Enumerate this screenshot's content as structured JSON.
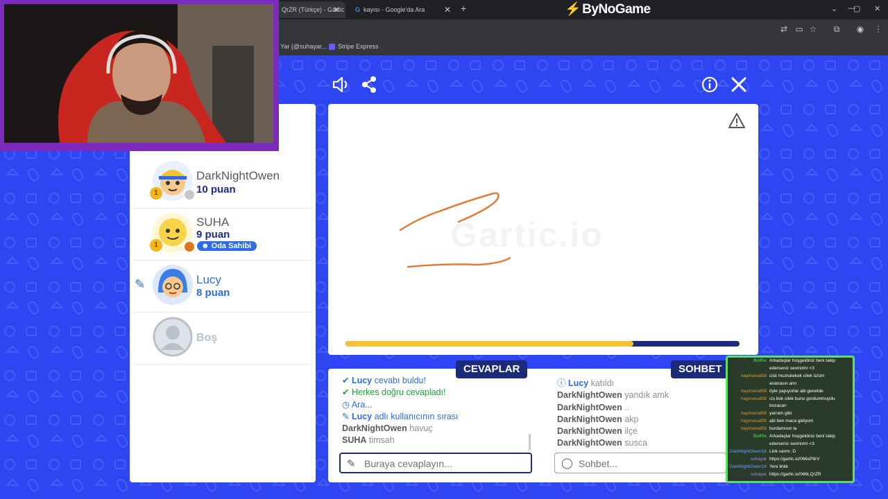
{
  "browser": {
    "tabs": [
      {
        "title": "QrZR (Türkçe) - Gartic",
        "active": true
      },
      {
        "title": "kayısı - Google'da Ara",
        "active": false
      }
    ],
    "brand": "ByNoGame",
    "bookmarks": [
      "Yar (@suhayar...",
      "Stripe Express"
    ]
  },
  "players": [
    {
      "name": "DarkNightOwen",
      "points": "10 puan",
      "rank": "1",
      "status_color": "#c8c8c8"
    },
    {
      "name": "SUHA",
      "points": "9 puan",
      "rank": "1",
      "badge": "Oda Sahibi",
      "status_color": "#e0761b"
    },
    {
      "name": "Lucy",
      "points": "8 puan",
      "drawing": true
    },
    {
      "name": "Boş"
    }
  ],
  "canvas": {
    "watermark": "Gartic.io",
    "progress": 0.73,
    "stroke_color": "#e07b39"
  },
  "answers": {
    "label": "CEVAPLAR",
    "messages": [
      {
        "user": "Lucy",
        "text": " cevabı buldu!",
        "kind": "system-blue"
      },
      {
        "user": "",
        "text": "Herkes doğru cevapladı!",
        "kind": "system-green"
      },
      {
        "user": "",
        "text": "Ara...",
        "kind": "system-blue"
      },
      {
        "user": "Lucy",
        "text": " adlı kullanıcının sırası",
        "kind": "system-blue"
      },
      {
        "user": "DarkNightOwen",
        "text": " havuç",
        "kind": "guess"
      },
      {
        "user": "SUHA",
        "text": " timsah",
        "kind": "guess"
      }
    ],
    "placeholder": "Buraya cevaplayın..."
  },
  "chat": {
    "label": "SOHBET",
    "messages": [
      {
        "user": "Lucy",
        "text": " katıldı",
        "kind": "system"
      },
      {
        "user": "DarkNightOwen",
        "text": " yandık amk"
      },
      {
        "user": "DarkNightOwen",
        "text": " .."
      },
      {
        "user": "DarkNightOwen",
        "text": " akp"
      },
      {
        "user": "DarkNightOwen",
        "text": " ilçe"
      },
      {
        "user": "DarkNightOwen",
        "text": " susca"
      }
    ],
    "placeholder": "Sohbet..."
  },
  "stream_chat": [
    {
      "user": "BotRix",
      "text": "Arkadaşlar hoşgeldiniz beni takip",
      "color": "#5ce06b"
    },
    {
      "user": "",
      "text": "ederseniz sevinirim <3",
      "color": "#5ce06b"
    },
    {
      "user": "hayirsevat58",
      "text": "cisli muzlukekek cilek üzüm",
      "color": "#d0a040"
    },
    {
      "user": "",
      "text": "ananasın amı",
      "color": "#d0a040"
    },
    {
      "user": "hayirsevat58",
      "text": "öyle yapıyorlar abi genelde",
      "color": "#d0a040"
    },
    {
      "user": "hayirsevat58",
      "text": "cis bok cilek bunu gordummuydu",
      "color": "#d0a040"
    },
    {
      "user": "",
      "text": "bozacan",
      "color": "#d0a040"
    },
    {
      "user": "hayirsevat58",
      "text": "yarram gibi",
      "color": "#d0a040"
    },
    {
      "user": "hayirsevat58",
      "text": "abi ben maca gidiyom",
      "color": "#d0a040"
    },
    {
      "user": "hayirsevat58",
      "text": "burdamısın la",
      "color": "#d0a040"
    },
    {
      "user": "BotRix",
      "text": "Arkadaşlar hoşgeldiniz beni takip",
      "color": "#5ce06b"
    },
    {
      "user": "",
      "text": "ederseniz sevinirim <3",
      "color": "#5ce06b"
    },
    {
      "user": "DarkNightOwen16",
      "text": "Link varmı :D",
      "color": "#6aa0ff"
    },
    {
      "user": "suhayar",
      "text": "https://gartic.io/066xP8rV",
      "color": "#b080ff"
    },
    {
      "user": "DarkNightOwen16",
      "text": "Yeni linkk",
      "color": "#6aa0ff"
    },
    {
      "user": "suhayar",
      "text": "https://gartic.io/066LQrZR",
      "color": "#b080ff"
    }
  ]
}
